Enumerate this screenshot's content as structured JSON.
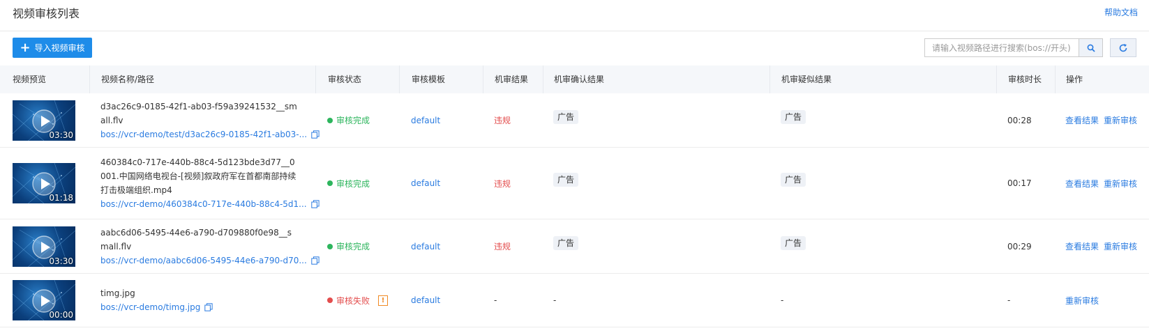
{
  "header": {
    "title": "视频审核列表",
    "help_link": "帮助文档"
  },
  "toolbar": {
    "import_label": "导入视频审核",
    "search_placeholder": "请输入视频路径进行搜索(bos://开头)",
    "search_value": ""
  },
  "table": {
    "columns": [
      "视频预览",
      "视频名称/路径",
      "审核状态",
      "审核模板",
      "机审结果",
      "机审确认结果",
      "机审疑似结果",
      "审核时长",
      "操作"
    ],
    "rows": [
      {
        "duration": "03:30",
        "name": "d3ac26c9-0185-42f1-ab03-f59a39241532__small.flv",
        "path": "bos://vcr-demo/test/d3ac26c9-0185-42f1-ab03-...",
        "status": "审核完成",
        "template": "default",
        "result": "违规",
        "confirmed": "广告",
        "suspected": "广告",
        "review_time": "00:28",
        "op_view": "查看结果",
        "op_redo": "重新审核"
      },
      {
        "duration": "01:18",
        "name": "460384c0-717e-440b-88c4-5d123bde3d77__0001.中国网络电视台-[视频]叙政府军在首都南部持续打击极端组织.mp4",
        "path": "bos://vcr-demo/460384c0-717e-440b-88c4-5d1...",
        "status": "审核完成",
        "template": "default",
        "result": "违规",
        "confirmed": "广告",
        "suspected": "广告",
        "review_time": "00:17",
        "op_view": "查看结果",
        "op_redo": "重新审核"
      },
      {
        "duration": "03:30",
        "name": "aabc6d06-5495-44e6-a790-d709880f0e98__small.flv",
        "path": "bos://vcr-demo/aabc6d06-5495-44e6-a790-d70...",
        "status": "审核完成",
        "template": "default",
        "result": "违规",
        "confirmed": "广告",
        "suspected": "广告",
        "review_time": "00:29",
        "op_view": "查看结果",
        "op_redo": "重新审核"
      },
      {
        "duration": "00:00",
        "name": "timg.jpg",
        "path": "bos://vcr-demo/timg.jpg",
        "status": "审核失败",
        "template": "default",
        "result": "-",
        "confirmed": "-",
        "suspected": "-",
        "review_time": "-",
        "op_redo": "重新审核"
      }
    ]
  },
  "colors": {
    "accent": "#1e8ce9",
    "link": "#2a7be0",
    "success": "#2db55d",
    "danger": "#e34d4d",
    "warning": "#f08a24"
  },
  "icons": [
    "plus-icon",
    "search-icon",
    "refresh-icon",
    "play-icon",
    "copy-icon",
    "warning-icon"
  ]
}
